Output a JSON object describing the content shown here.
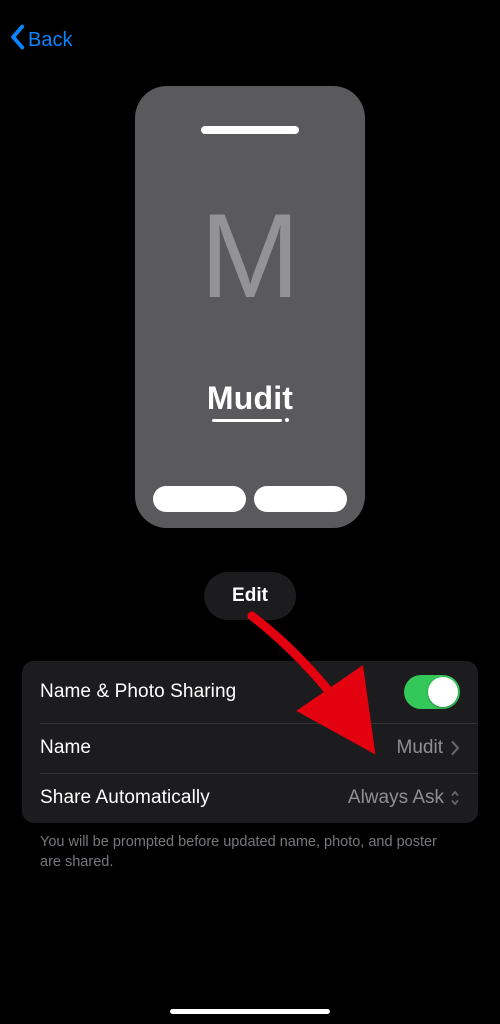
{
  "nav": {
    "back_label": "Back"
  },
  "poster": {
    "initial": "M",
    "name": "Mudit"
  },
  "edit_label": "Edit",
  "settings": {
    "sharing_label": "Name & Photo Sharing",
    "sharing_on": true,
    "name_label": "Name",
    "name_value": "Mudit",
    "auto_label": "Share Automatically",
    "auto_value": "Always Ask"
  },
  "footer": "You will be prompted before updated name, photo, and poster are shared.",
  "colors": {
    "accent_blue": "#0A84FF",
    "toggle_on": "#34C759",
    "annotation": "#E3000F"
  }
}
